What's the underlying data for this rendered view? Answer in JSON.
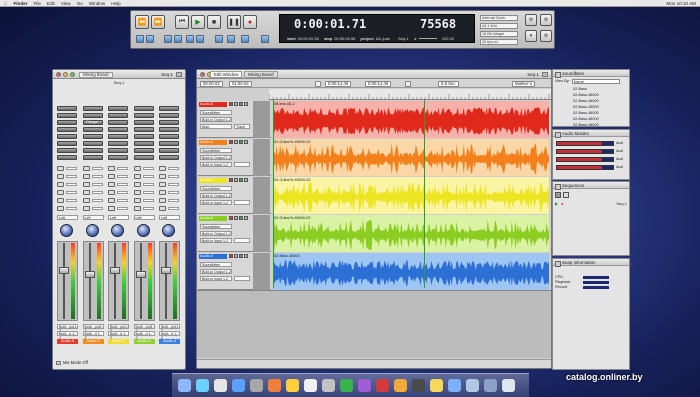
{
  "menubar": {
    "items": [
      "Finder",
      "File",
      "Edit",
      "View",
      "Go",
      "Window",
      "Help"
    ],
    "clock": "Mon 10:10 AM"
  },
  "transport": {
    "timecode": "0:00:01.71",
    "samples": "75568",
    "start_label": "start",
    "start_value": "00:00:00.55",
    "stop_label": "stop",
    "stop_value": "00:00:00.55",
    "project_label": "project",
    "project_value": "AD-junk",
    "seq": "Seq-1",
    "tempo": "120.00",
    "right_controls": [
      "Internal Clock",
      "44.1 kHz",
      "16 Bit Integer",
      "30 fps nd"
    ]
  },
  "mixer": {
    "window_title": "Mixing Board",
    "tab": "Mixing Board",
    "seq": "Seq-1",
    "channel_menu": "Seq-1",
    "plugin_label": "Flanger",
    "pans": [
      "Left",
      "Left",
      "Left",
      "Left",
      "Left"
    ],
    "outputs": [
      "Built-..put1-2",
      "Built-..put1-2",
      "Built-..put1-2",
      "Built-..put1-2",
      "Built-..put1-2"
    ],
    "inputs": [
      "Built-..d 1-2",
      "Built-..d 1-2",
      "Built-..d 1-2",
      "Built-..d 1-2",
      "Built-..d 1-2"
    ],
    "channels": [
      {
        "name": "Audio-5",
        "color": "#e63d2b"
      },
      {
        "name": "Audio-3",
        "color": "#f08b1c"
      },
      {
        "name": "Audio-2",
        "color": "#f0dc2a"
      },
      {
        "name": "Audio-6",
        "color": "#8fd22f"
      },
      {
        "name": "Audio-4",
        "color": "#3b7fe0"
      }
    ],
    "footer": "Mix Mode Off"
  },
  "edit": {
    "tab": "Edit Window",
    "seq": "Seq-1",
    "start": "00:00.02",
    "end": "01:50.02",
    "mid1": "0:00:12.46",
    "mid2": "0:00:12.46",
    "snap": "0.8 Sec",
    "marker": "Marker-1",
    "tracks": [
      {
        "name": "Audio-5",
        "clip": "08-test-08-2",
        "color": "#e0281b",
        "lane": "#f6b1ab",
        "src": "Soundbites",
        "out": "Built-in Output 1-2",
        "in": "Auto",
        "mode": "Track"
      },
      {
        "name": "Audio-3",
        "clip": "02-Guitar%-48000-02",
        "color": "#f3801a",
        "lane": "#fbd7a8",
        "src": "Soundbites",
        "out": "Built-in Output 1-2",
        "in": "Built-in Input 1-2",
        "mode": ""
      },
      {
        "name": "Audio-2",
        "clip": "02-Guitar%-48000-02",
        "color": "#ece521",
        "lane": "#faf4a4",
        "src": "Soundbites",
        "out": "Built-in Output 1-2",
        "in": "Built-in Input 1-2",
        "mode": ""
      },
      {
        "name": "Audio-6",
        "clip": "02-Guitar%-48000-02",
        "color": "#8ccd22",
        "lane": "#d9f2a3",
        "src": "Soundbites",
        "out": "Built-in Output 1-2",
        "in": "Built-in Input 1-2",
        "mode": ""
      },
      {
        "name": "Audio-4",
        "clip": "02-Bass-48000",
        "color": "#2c6fd5",
        "lane": "#9fc5f3",
        "src": "Soundbites",
        "out": "Built-in Output 1-2",
        "in": "Built-in Input 1-2",
        "mode": ""
      }
    ]
  },
  "soundbites": {
    "title": "Soundbites",
    "view_by_label": "View By:",
    "view_by": "Name",
    "items": [
      "02-Bass",
      "02-Bass-48000",
      "02-Bass-48000",
      "02-Bass-48000",
      "02-Bass-48000",
      "02-Bass-48000",
      "02-Bass-48000"
    ]
  },
  "audio_monitor": {
    "title": "Audio Monitor",
    "labels": [
      "Audi",
      "Audi",
      "Audi",
      "Audi"
    ]
  },
  "sequences": {
    "title": "Sequences",
    "item": "Seq-1"
  },
  "snap": {
    "title": "Snap Information",
    "rows": [
      "CPU",
      "Playback",
      "Record"
    ]
  },
  "watermark": "catalog.onliner.by",
  "colors": {
    "red": "#e0281b",
    "orange": "#f3801a",
    "yellow": "#ece521",
    "green": "#8ccd22",
    "blue": "#2c6fd5"
  }
}
